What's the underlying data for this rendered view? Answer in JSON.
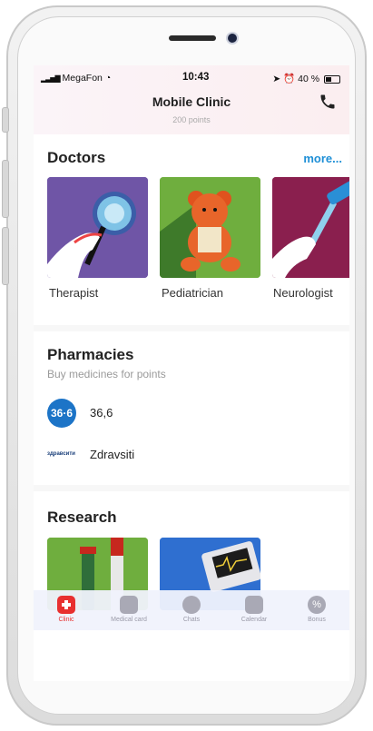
{
  "status_bar": {
    "carrier": "MegaFon",
    "time": "10:43",
    "battery": "40 %"
  },
  "header": {
    "title": "Mobile Clinic",
    "points": "200 points"
  },
  "doctors": {
    "title": "Doctors",
    "more": "more...",
    "items": [
      {
        "label": "Therapist"
      },
      {
        "label": "Pediatrician"
      },
      {
        "label": "Neurologist"
      }
    ]
  },
  "pharmacies": {
    "title": "Pharmacies",
    "subtitle": "Buy medicines for points",
    "items": [
      {
        "logo": "36·6",
        "name": "36,6"
      },
      {
        "logo": "здравсити",
        "name": "Zdravsiti"
      }
    ]
  },
  "research": {
    "title": "Research"
  },
  "tabbar": {
    "items": [
      {
        "label": "Clinic",
        "icon": "first-aid-icon",
        "active": true
      },
      {
        "label": "Medical card",
        "icon": "id-card-icon"
      },
      {
        "label": "Chats",
        "icon": "chat-bubble-icon"
      },
      {
        "label": "Calendar",
        "icon": "calendar-icon"
      },
      {
        "label": "Bonus",
        "icon": "percent-icon"
      }
    ]
  },
  "colors": {
    "accent": "#1e8fd6",
    "active_tab": "#e8302f",
    "pharmacy_brand": "#1c74c7"
  }
}
